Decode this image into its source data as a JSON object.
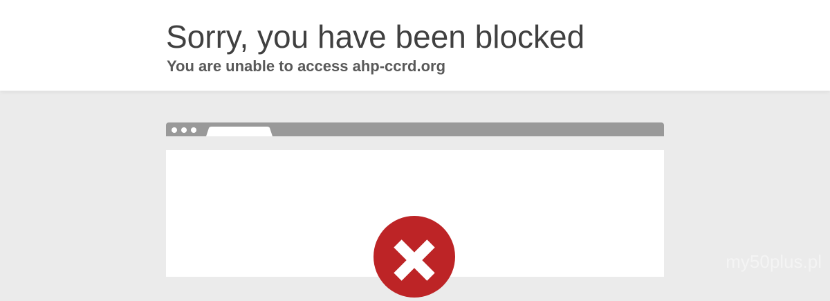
{
  "header": {
    "title": "Sorry, you have been blocked",
    "subtitle": "You are unable to access ahp-ccrd.org"
  },
  "illustration": {
    "browser_icon": "browser-window-icon",
    "error_icon": "error-x-icon",
    "error_color": "#bd2426",
    "frame_color": "#999999"
  },
  "watermark": "my50plus.pl"
}
